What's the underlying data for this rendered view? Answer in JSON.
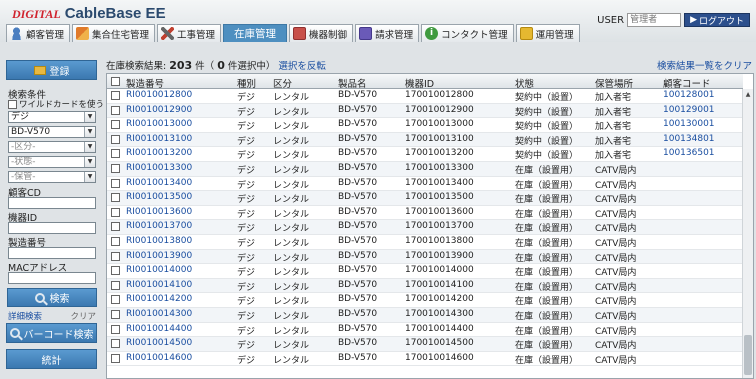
{
  "app": {
    "logo_part1": "DIGITAL",
    "logo_part2": "CableBase EE",
    "user_label": "USER",
    "user_placeholder": "管理者",
    "logout_label": "ログアウト"
  },
  "tabs": [
    {
      "label": "顧客管理",
      "icon": "user-icon"
    },
    {
      "label": "集合住宅管理",
      "icon": "apartment-icon"
    },
    {
      "label": "工事管理",
      "icon": "tools-icon"
    },
    {
      "label": "在庫管理",
      "icon": "",
      "active": true
    },
    {
      "label": "機器制御",
      "icon": "device-icon"
    },
    {
      "label": "請求管理",
      "icon": "calculator-icon"
    },
    {
      "label": "コンタクト管理",
      "icon": "info-icon"
    },
    {
      "label": "運用管理",
      "icon": "folder-icon"
    }
  ],
  "sidebar": {
    "register_label": "登録",
    "search_title": "検索条件",
    "wildcard_label": "ワイルドカードを使う",
    "select_type": "デジ",
    "select_model": "BD-V570",
    "select_section": "-区分-",
    "select_status": "-状態-",
    "select_storage": "-保管-",
    "customer_cd_label": "顧客CD",
    "device_id_label": "機器ID",
    "serial_label": "製造番号",
    "mac_label": "MACアドレス",
    "search_label": "検索",
    "detail_search": "詳細検索",
    "clear": "クリア",
    "barcode_label": "バーコード検索",
    "stats_label": "統計"
  },
  "main": {
    "result_label": "在庫検索結果:",
    "result_count": "203",
    "result_unit": "件（",
    "selected_count": "0",
    "selected_unit": "件選択中）",
    "invert_link": "選択を反転",
    "clear_results": "検索結果一覧をクリア",
    "columns": [
      "製造番号",
      "種別",
      "区分",
      "製品名",
      "機器ID",
      "状態",
      "保管場所",
      "顧客コード"
    ]
  },
  "rows": [
    [
      "RI0010012800",
      "デジ",
      "レンタル",
      "BD-V570",
      "170010012800",
      "契約中（設置）",
      "加入者宅",
      "100128001"
    ],
    [
      "RI0010012900",
      "デジ",
      "レンタル",
      "BD-V570",
      "170010012900",
      "契約中（設置）",
      "加入者宅",
      "100129001"
    ],
    [
      "RI0010013000",
      "デジ",
      "レンタル",
      "BD-V570",
      "170010013000",
      "契約中（設置）",
      "加入者宅",
      "100130001"
    ],
    [
      "RI0010013100",
      "デジ",
      "レンタル",
      "BD-V570",
      "170010013100",
      "契約中（設置）",
      "加入者宅",
      "100134801"
    ],
    [
      "RI0010013200",
      "デジ",
      "レンタル",
      "BD-V570",
      "170010013200",
      "契約中（設置）",
      "加入者宅",
      "100136501"
    ],
    [
      "RI0010013300",
      "デジ",
      "レンタル",
      "BD-V570",
      "170010013300",
      "在庫（設置用）",
      "CATV局内",
      ""
    ],
    [
      "RI0010013400",
      "デジ",
      "レンタル",
      "BD-V570",
      "170010013400",
      "在庫（設置用）",
      "CATV局内",
      ""
    ],
    [
      "RI0010013500",
      "デジ",
      "レンタル",
      "BD-V570",
      "170010013500",
      "在庫（設置用）",
      "CATV局内",
      ""
    ],
    [
      "RI0010013600",
      "デジ",
      "レンタル",
      "BD-V570",
      "170010013600",
      "在庫（設置用）",
      "CATV局内",
      ""
    ],
    [
      "RI0010013700",
      "デジ",
      "レンタル",
      "BD-V570",
      "170010013700",
      "在庫（設置用）",
      "CATV局内",
      ""
    ],
    [
      "RI0010013800",
      "デジ",
      "レンタル",
      "BD-V570",
      "170010013800",
      "在庫（設置用）",
      "CATV局内",
      ""
    ],
    [
      "RI0010013900",
      "デジ",
      "レンタル",
      "BD-V570",
      "170010013900",
      "在庫（設置用）",
      "CATV局内",
      ""
    ],
    [
      "RI0010014000",
      "デジ",
      "レンタル",
      "BD-V570",
      "170010014000",
      "在庫（設置用）",
      "CATV局内",
      ""
    ],
    [
      "RI0010014100",
      "デジ",
      "レンタル",
      "BD-V570",
      "170010014100",
      "在庫（設置用）",
      "CATV局内",
      ""
    ],
    [
      "RI0010014200",
      "デジ",
      "レンタル",
      "BD-V570",
      "170010014200",
      "在庫（設置用）",
      "CATV局内",
      ""
    ],
    [
      "RI0010014300",
      "デジ",
      "レンタル",
      "BD-V570",
      "170010014300",
      "在庫（設置用）",
      "CATV局内",
      ""
    ],
    [
      "RI0010014400",
      "デジ",
      "レンタル",
      "BD-V570",
      "170010014400",
      "在庫（設置用）",
      "CATV局内",
      ""
    ],
    [
      "RI0010014500",
      "デジ",
      "レンタル",
      "BD-V570",
      "170010014500",
      "在庫（設置用）",
      "CATV局内",
      ""
    ],
    [
      "RI0010014600",
      "デジ",
      "レンタル",
      "BD-V570",
      "170010014600",
      "在庫（設置用）",
      "CATV局内",
      ""
    ]
  ]
}
